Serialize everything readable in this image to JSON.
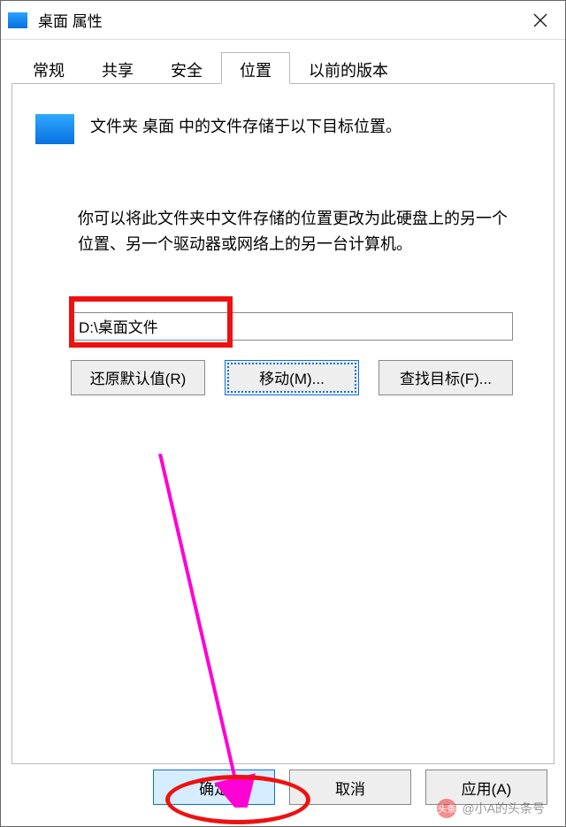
{
  "title": "桌面 属性",
  "tabs": {
    "general": "常规",
    "sharing": "共享",
    "security": "安全",
    "location": "位置",
    "previous": "以前的版本"
  },
  "location_panel": {
    "description": "文件夹 桌面 中的文件存储于以下目标位置。",
    "help": "你可以将此文件夹中文件存储的位置更改为此硬盘上的另一个位置、另一个驱动器或网络上的另一台计算机。",
    "path_value": "D:\\桌面文件",
    "restore_label": "还原默认值(R)",
    "move_label": "移动(M)...",
    "find_label": "查找目标(F)..."
  },
  "buttons": {
    "ok": "确定",
    "cancel": "取消",
    "apply": "应用(A)"
  },
  "watermark": {
    "prefix": "头条",
    "text": "@小A的头条号"
  }
}
